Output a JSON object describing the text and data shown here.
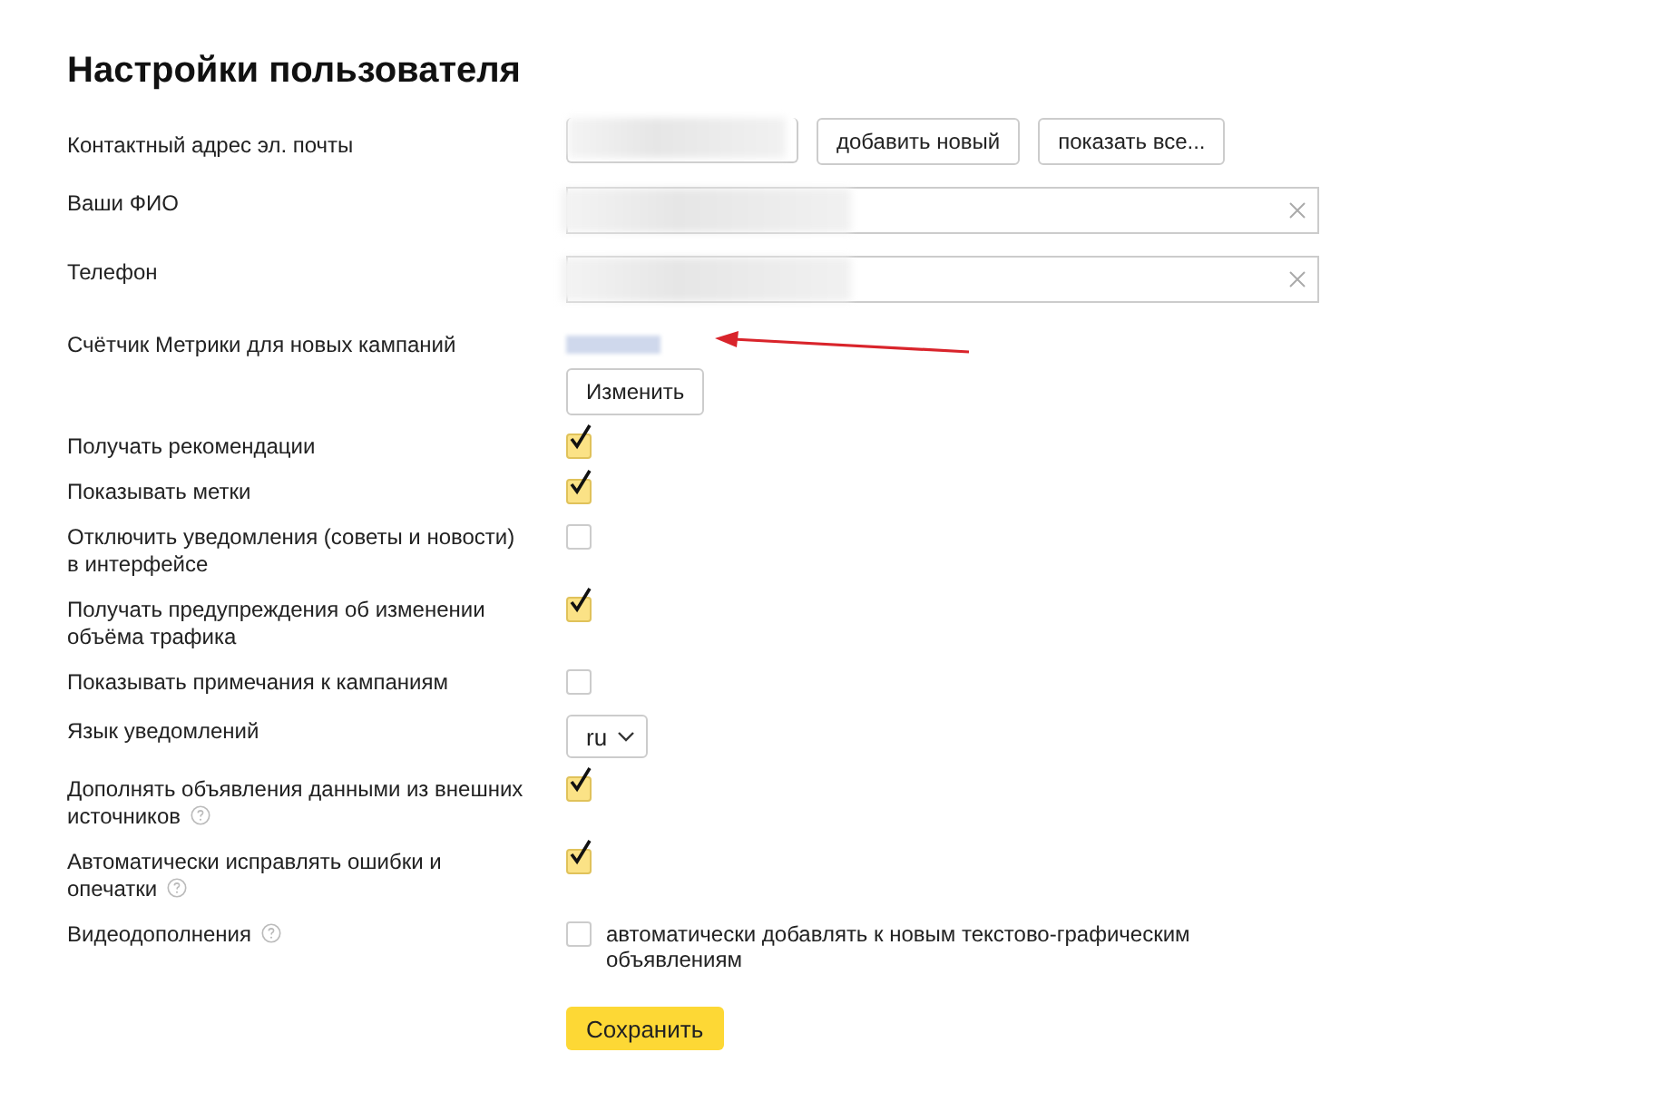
{
  "title": "Настройки пользователя",
  "rows": [
    {
      "kind": "email",
      "label": "Контактный адрес эл. почты",
      "help": false,
      "buttons": [
        "добавить новый",
        "показать все..."
      ]
    },
    {
      "kind": "field",
      "label": "Ваши ФИО",
      "help": false
    },
    {
      "kind": "field",
      "label": "Телефон",
      "help": false
    },
    {
      "kind": "counter",
      "label": "Счётчик Метрики для новых кампаний",
      "help": false,
      "button": "Изменить"
    },
    {
      "kind": "checkbox",
      "label": "Получать рекомендации",
      "help": false,
      "checked": true
    },
    {
      "kind": "checkbox",
      "label": "Показывать метки",
      "help": false,
      "checked": true
    },
    {
      "kind": "checkbox",
      "label": "Отключить уведомления (советы и новости) в интерфейсе",
      "help": false,
      "checked": false
    },
    {
      "kind": "checkbox",
      "label": "Получать предупреждения об изменении объёма трафика",
      "help": false,
      "checked": true
    },
    {
      "kind": "checkbox",
      "label": "Показывать примечания к кампаниям",
      "help": false,
      "checked": false
    },
    {
      "kind": "select",
      "label": "Язык уведомлений",
      "help": false,
      "value": "ru"
    },
    {
      "kind": "checkbox",
      "label": "Дополнять объявления данными из внешних источников",
      "help": true,
      "checked": true
    },
    {
      "kind": "checkbox",
      "label": "Автоматически исправлять ошибки и опечатки",
      "help": true,
      "checked": true
    },
    {
      "kind": "checkbox",
      "label": "Видеодополнения",
      "help": true,
      "checked": false,
      "text": "автоматически добавлять к новым текстово-графическим объявлениям"
    }
  ],
  "save_button": "Сохранить"
}
